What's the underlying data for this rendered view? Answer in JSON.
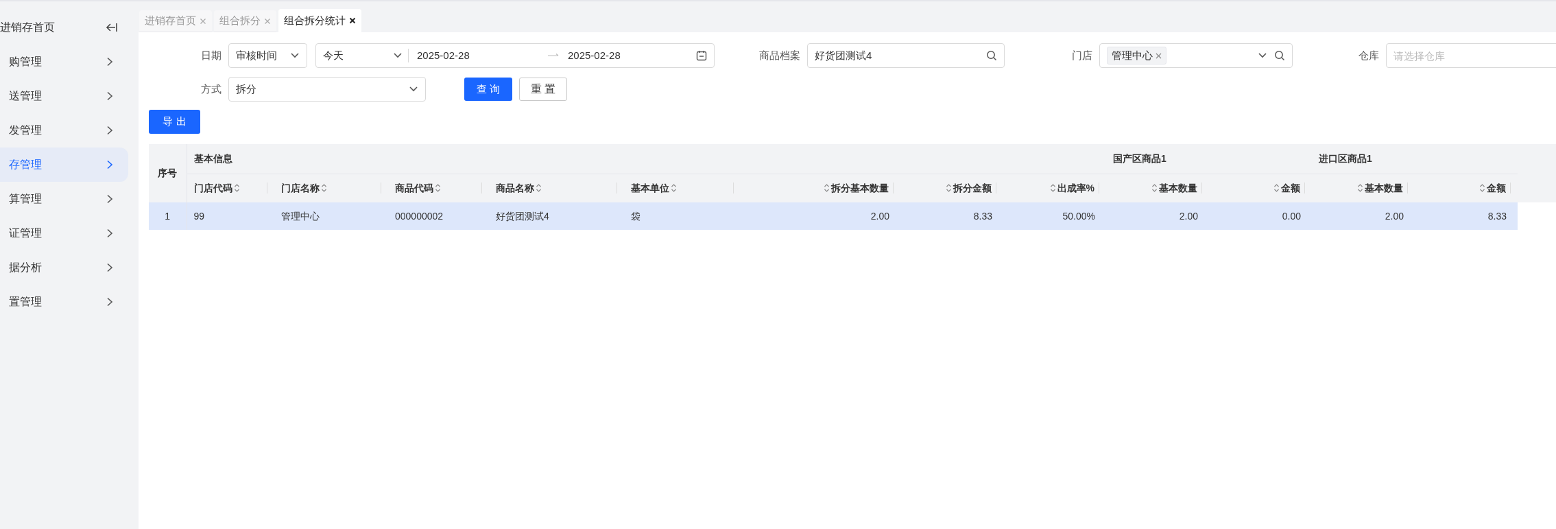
{
  "sidebar": {
    "items": [
      {
        "label": "进销存首页",
        "selected": false,
        "kind": "home"
      },
      {
        "label": "购管理",
        "selected": false,
        "kind": "menu"
      },
      {
        "label": "送管理",
        "selected": false,
        "kind": "menu"
      },
      {
        "label": "发管理",
        "selected": false,
        "kind": "menu"
      },
      {
        "label": "存管理",
        "selected": true,
        "kind": "menu"
      },
      {
        "label": "算管理",
        "selected": false,
        "kind": "menu"
      },
      {
        "label": "证管理",
        "selected": false,
        "kind": "menu"
      },
      {
        "label": "据分析",
        "selected": false,
        "kind": "menu"
      },
      {
        "label": "置管理",
        "selected": false,
        "kind": "menu"
      }
    ]
  },
  "tabs": [
    {
      "label": "进销存首页",
      "selected": false
    },
    {
      "label": "组合拆分",
      "selected": false
    },
    {
      "label": "组合拆分统计",
      "selected": true
    }
  ],
  "filters": {
    "date": {
      "label": "日期",
      "type_value": "审核时间",
      "range_value": "今天",
      "start": "2025-02-28",
      "end": "2025-02-28"
    },
    "product": {
      "label": "商品档案",
      "value": "好货团测试4"
    },
    "store": {
      "label": "门店",
      "tag": "管理中心"
    },
    "warehouse": {
      "label": "仓库",
      "placeholder": "请选择仓库"
    },
    "method": {
      "label": "方式",
      "value": "拆分"
    },
    "query_button": "查 询",
    "reset_button": "重 置"
  },
  "export_button": "导 出",
  "table": {
    "index_header": "序号",
    "groups": [
      {
        "title": "基本信息",
        "columns": [
          {
            "label": "门店代码",
            "kind": "text"
          },
          {
            "label": "门店名称",
            "kind": "text"
          },
          {
            "label": "商品代码",
            "kind": "text"
          },
          {
            "label": "商品名称",
            "kind": "text"
          },
          {
            "label": "基本单位",
            "kind": "text"
          },
          {
            "label": "拆分基本数量",
            "kind": "number"
          },
          {
            "label": "拆分金额",
            "kind": "number"
          },
          {
            "label": "出成率%",
            "kind": "number"
          }
        ]
      },
      {
        "title": "国产区商品1",
        "columns": [
          {
            "label": "基本数量",
            "kind": "number"
          },
          {
            "label": "金额",
            "kind": "number"
          }
        ]
      },
      {
        "title": "进口区商品1",
        "columns": [
          {
            "label": "基本数量",
            "kind": "number"
          },
          {
            "label": "金额",
            "kind": "number"
          }
        ]
      }
    ],
    "rows": [
      {
        "index": "1",
        "selected": true,
        "cells": [
          "99",
          "管理中心",
          "000000002",
          "好货团测试4",
          "袋",
          "2.00",
          "8.33",
          "50.00%",
          "2.00",
          "0.00",
          "2.00",
          "8.33"
        ]
      }
    ]
  }
}
